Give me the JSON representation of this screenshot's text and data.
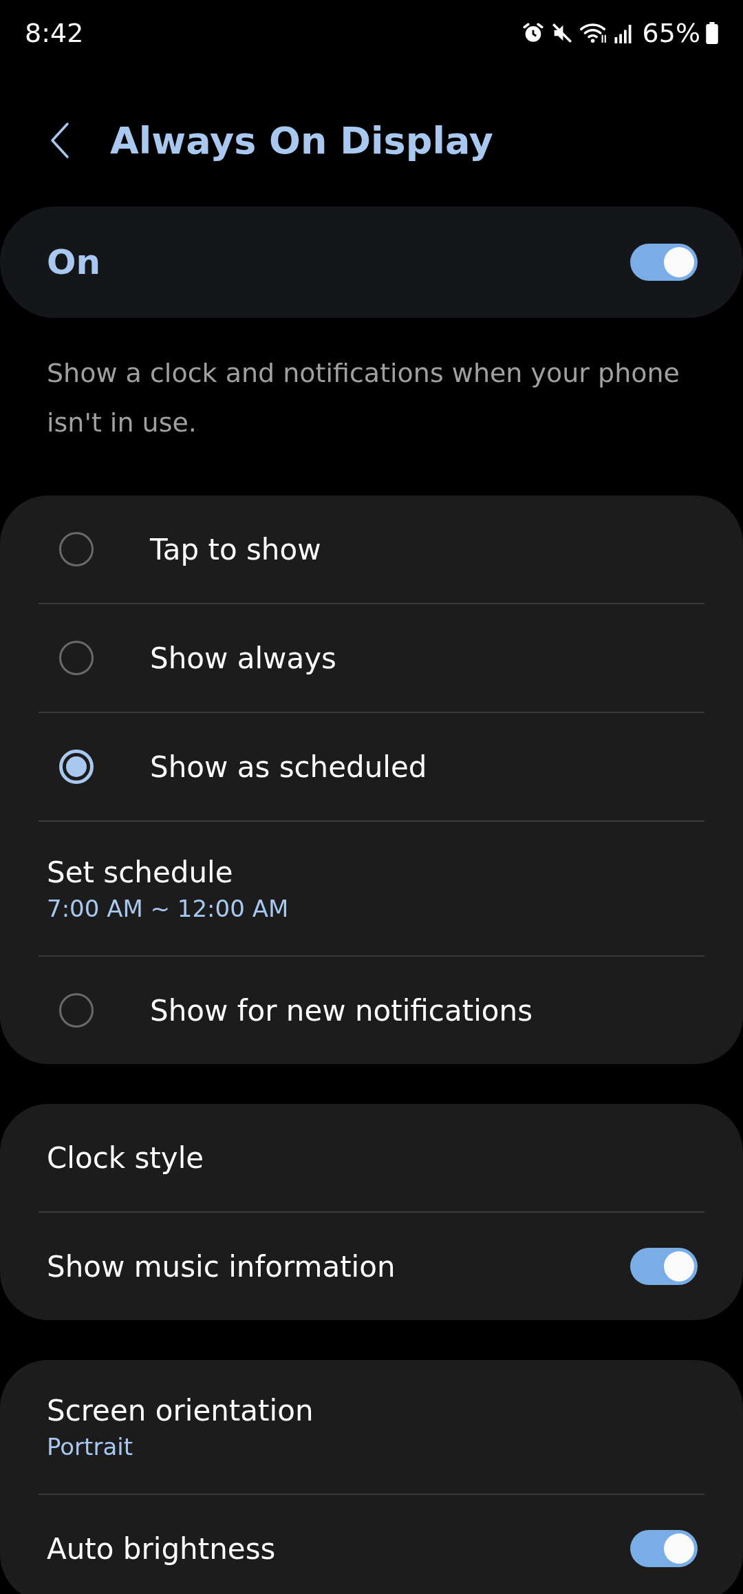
{
  "status_bar": {
    "time": "8:42",
    "battery": "65%"
  },
  "header": {
    "title": "Always On Display"
  },
  "master": {
    "label": "On",
    "on": true
  },
  "description": "Show a clock and notifications when your phone isn't in use.",
  "groups": [
    {
      "items": [
        {
          "kind": "radio",
          "label": "Tap to show",
          "selected": false
        },
        {
          "kind": "radio",
          "label": "Show always",
          "selected": false
        },
        {
          "kind": "radio",
          "label": "Show as scheduled",
          "selected": true
        },
        {
          "kind": "value",
          "label": "Set schedule",
          "value": "7:00 AM ~ 12:00 AM"
        },
        {
          "kind": "radio",
          "label": "Show for new notifications",
          "selected": false
        }
      ]
    },
    {
      "items": [
        {
          "kind": "link",
          "label": "Clock style"
        },
        {
          "kind": "switch",
          "label": "Show music information",
          "on": true
        }
      ]
    },
    {
      "items": [
        {
          "kind": "value",
          "label": "Screen orientation",
          "value": "Portrait"
        },
        {
          "kind": "switch",
          "label": "Auto brightness",
          "on": true
        }
      ]
    }
  ]
}
